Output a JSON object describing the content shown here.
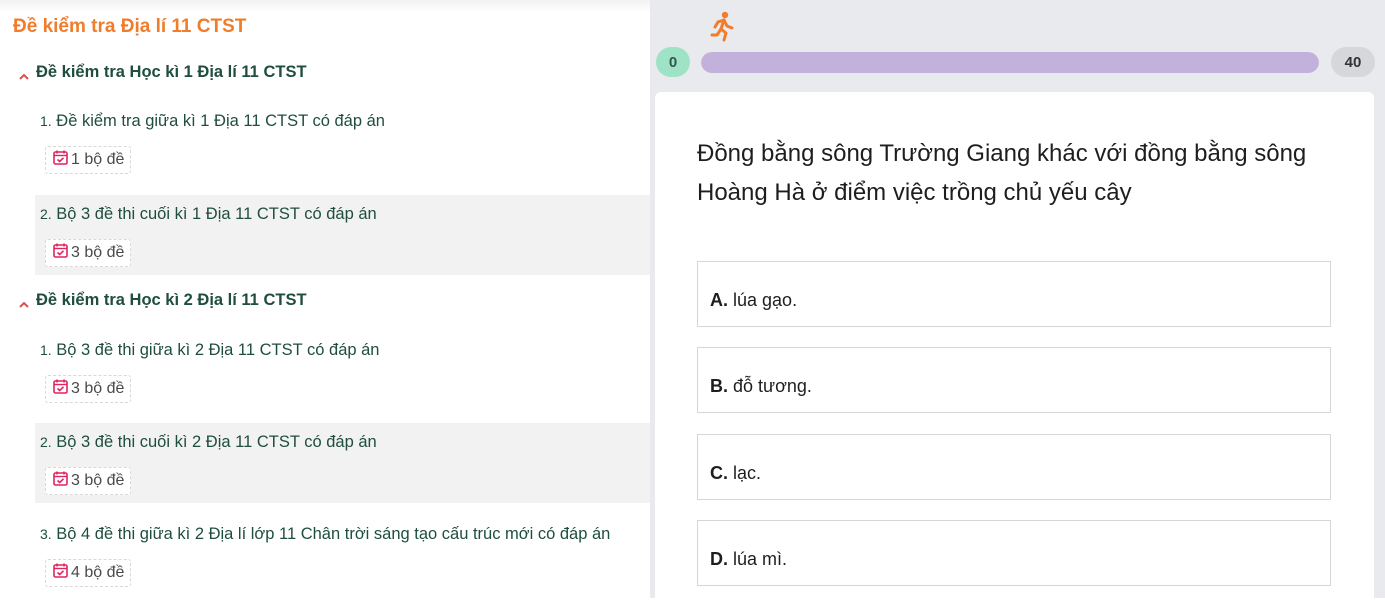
{
  "left": {
    "title": "Đề kiểm tra Địa lí 11 CTST",
    "sections": [
      {
        "title": "Đề kiểm tra Học kì 1 Địa lí 11 CTST",
        "items": [
          {
            "num": "1.",
            "text": "Đề kiểm tra giữa kì 1 Địa 11 CTST có đáp án",
            "badge": "1 bộ đề"
          },
          {
            "num": "2.",
            "text": "Bộ 3 đề thi cuối kì 1 Địa 11 CTST có đáp án",
            "badge": "3 bộ đề"
          }
        ]
      },
      {
        "title": "Đề kiểm tra Học kì 2 Địa lí 11 CTST",
        "items": [
          {
            "num": "1.",
            "text": "Bộ 3 đề thi giữa kì 2 Địa 11 CTST có đáp án",
            "badge": "3 bộ đề"
          },
          {
            "num": "2.",
            "text": "Bộ 3 đề thi cuối kì 2 Địa 11 CTST có đáp án",
            "badge": "3 bộ đề"
          },
          {
            "num": "3.",
            "text": "Bộ 4 đề thi giữa kì 2 Địa lí lớp 11 Chân trời sáng tạo cấu trúc mới có đáp án",
            "badge": "4 bộ đề"
          }
        ]
      }
    ],
    "icons": {
      "section_toggle": "chevron-up-icon",
      "badge": "calendar-check-icon"
    },
    "colors": {
      "title": "#f07c2c",
      "text": "#1f4e3d",
      "badge_icon": "#e0245e"
    }
  },
  "right": {
    "progress": {
      "start_label": "0",
      "end_label": "40",
      "fraction": 1.0,
      "icon": "runner-icon"
    },
    "question": "Đồng bằng sông Trường Giang khác với đồng bằng sông Hoàng Hà ở điểm việc trồng chủ yếu cây",
    "options": [
      {
        "letter": "A.",
        "text": "lúa gạo."
      },
      {
        "letter": "B.",
        "text": "đỗ tương."
      },
      {
        "letter": "C.",
        "text": "lạc."
      },
      {
        "letter": "D.",
        "text": "lúa mì."
      }
    ],
    "colors": {
      "progress_fill": "#c2b1da",
      "start_pill": "#9fe3c6",
      "runner": "#f07c2c"
    }
  }
}
